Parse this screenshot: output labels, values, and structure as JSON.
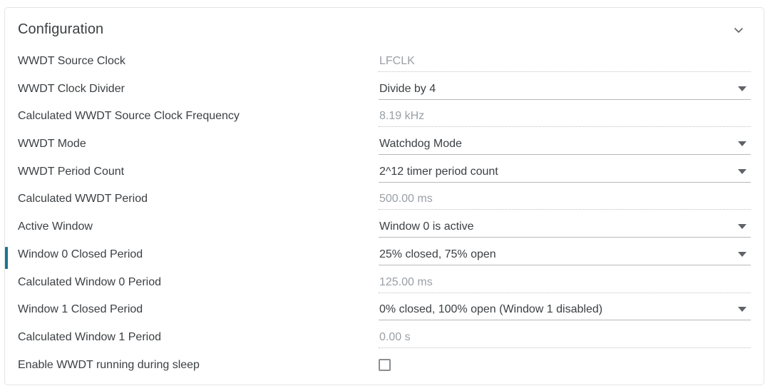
{
  "panel": {
    "title": "Configuration",
    "collapse_icon": "chevron-down-icon",
    "accent_color": "#1f7391",
    "label_color": "#3c4043",
    "readonly_value_color": "#9aa0a6",
    "border_color": "#e3e5e8"
  },
  "rows": [
    {
      "label": "WWDT Source Clock",
      "value": "LFCLK",
      "type": "readonly",
      "marked": false
    },
    {
      "label": "WWDT Clock Divider",
      "value": "Divide by 4",
      "type": "dropdown",
      "marked": false
    },
    {
      "label": "Calculated WWDT Source Clock Frequency",
      "value": "8.19 kHz",
      "type": "readonly",
      "marked": false
    },
    {
      "label": "WWDT Mode",
      "value": "Watchdog Mode",
      "type": "dropdown",
      "marked": false
    },
    {
      "label": "WWDT Period Count",
      "value": "2^12 timer period count",
      "type": "dropdown",
      "marked": false
    },
    {
      "label": "Calculated WWDT Period",
      "value": "500.00 ms",
      "type": "readonly",
      "marked": false
    },
    {
      "label": "Active Window",
      "value": "Window 0 is active",
      "type": "dropdown",
      "marked": false
    },
    {
      "label": "Window 0 Closed Period",
      "value": "25% closed, 75% open",
      "type": "dropdown",
      "marked": true
    },
    {
      "label": "Calculated Window 0 Period",
      "value": "125.00 ms",
      "type": "readonly",
      "marked": false
    },
    {
      "label": "Window 1 Closed Period",
      "value": "0% closed, 100% open (Window 1 disabled)",
      "type": "dropdown",
      "marked": false
    },
    {
      "label": "Calculated Window 1 Period",
      "value": "0.00 s",
      "type": "readonly",
      "marked": false
    },
    {
      "label": "Enable WWDT running during sleep",
      "value": "",
      "type": "checkbox",
      "checked": false,
      "marked": false
    }
  ]
}
